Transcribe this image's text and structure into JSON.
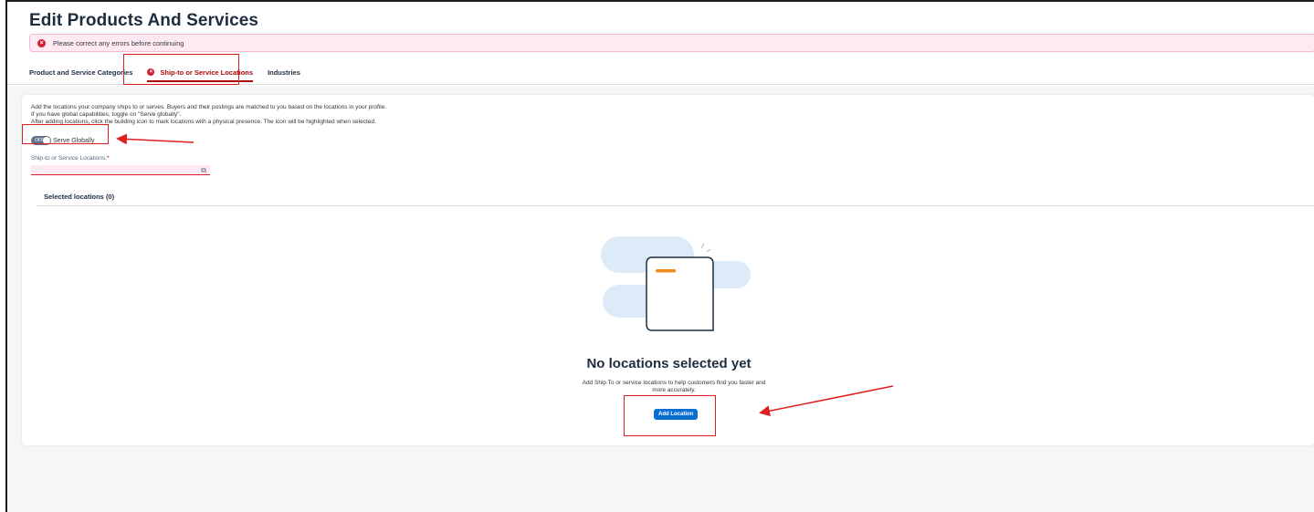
{
  "header": {
    "title": "Edit Products And Services",
    "error_message": "Please correct any errors before continuing"
  },
  "tabs": [
    {
      "label": "Product and Service Categories",
      "active": false,
      "error": false
    },
    {
      "label": "Ship-to or Service Locations",
      "active": true,
      "error": true
    },
    {
      "label": "Industries",
      "active": false,
      "error": false
    }
  ],
  "content": {
    "description": [
      "Add the locations your company ships to or serves. Buyers and their postings are matched to you based on the locations in your profile.",
      "If you have global capabilities, toggle on \"Serve globally\".",
      "After adding locations, click the building icon to mark locations with a physical presence. The icon will be highlighted when selected."
    ],
    "toggle_state": "OFF",
    "toggle_label": "Serve Globally",
    "field_label": "Ship-to or Service Locations:",
    "field_required_mark": "*",
    "field_value": "",
    "selected_title": "Selected locations (0)",
    "empty_title": "No locations selected yet",
    "empty_subtitle": "Add Ship To or service locations to help customers find you faster and more accurately.",
    "add_button": "Add Location"
  },
  "colors": {
    "error": "#aa0808",
    "primary_button": "#0a6ed1",
    "annotation": "#e02020"
  },
  "icons": {
    "error": "error-circle-icon",
    "value_help": "value-help-icon",
    "illustration": "empty-document-illustration"
  }
}
